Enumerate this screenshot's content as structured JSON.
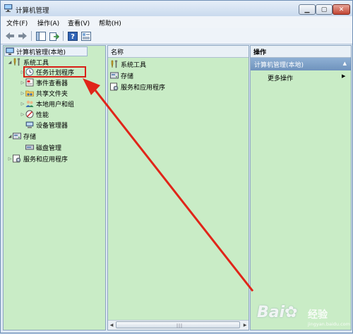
{
  "window": {
    "title": "计算机管理"
  },
  "menu": [
    "文件(F)",
    "操作(A)",
    "查看(V)",
    "帮助(H)"
  ],
  "tree": {
    "root": "计算机管理(本地)",
    "items": [
      {
        "label": "系统工具"
      },
      {
        "label": "任务计划程序"
      },
      {
        "label": "事件查看器"
      },
      {
        "label": "共享文件夹"
      },
      {
        "label": "本地用户和组"
      },
      {
        "label": "性能"
      },
      {
        "label": "设备管理器"
      },
      {
        "label": "存储"
      },
      {
        "label": "磁盘管理"
      },
      {
        "label": "服务和应用程序"
      }
    ]
  },
  "list": {
    "column": "名称",
    "rows": [
      "系统工具",
      "存储",
      "服务和应用程序"
    ]
  },
  "actions": {
    "header": "操作",
    "group": "计算机管理(本地)",
    "items": [
      "更多操作"
    ]
  },
  "watermark": {
    "brand": "Bai",
    "suffix": "经验",
    "url": "jingyan.baidu.com"
  },
  "colors": {
    "pane_bg": "#c9ecc6",
    "highlight": "#d81f16",
    "action_header": "#6f93bd"
  }
}
